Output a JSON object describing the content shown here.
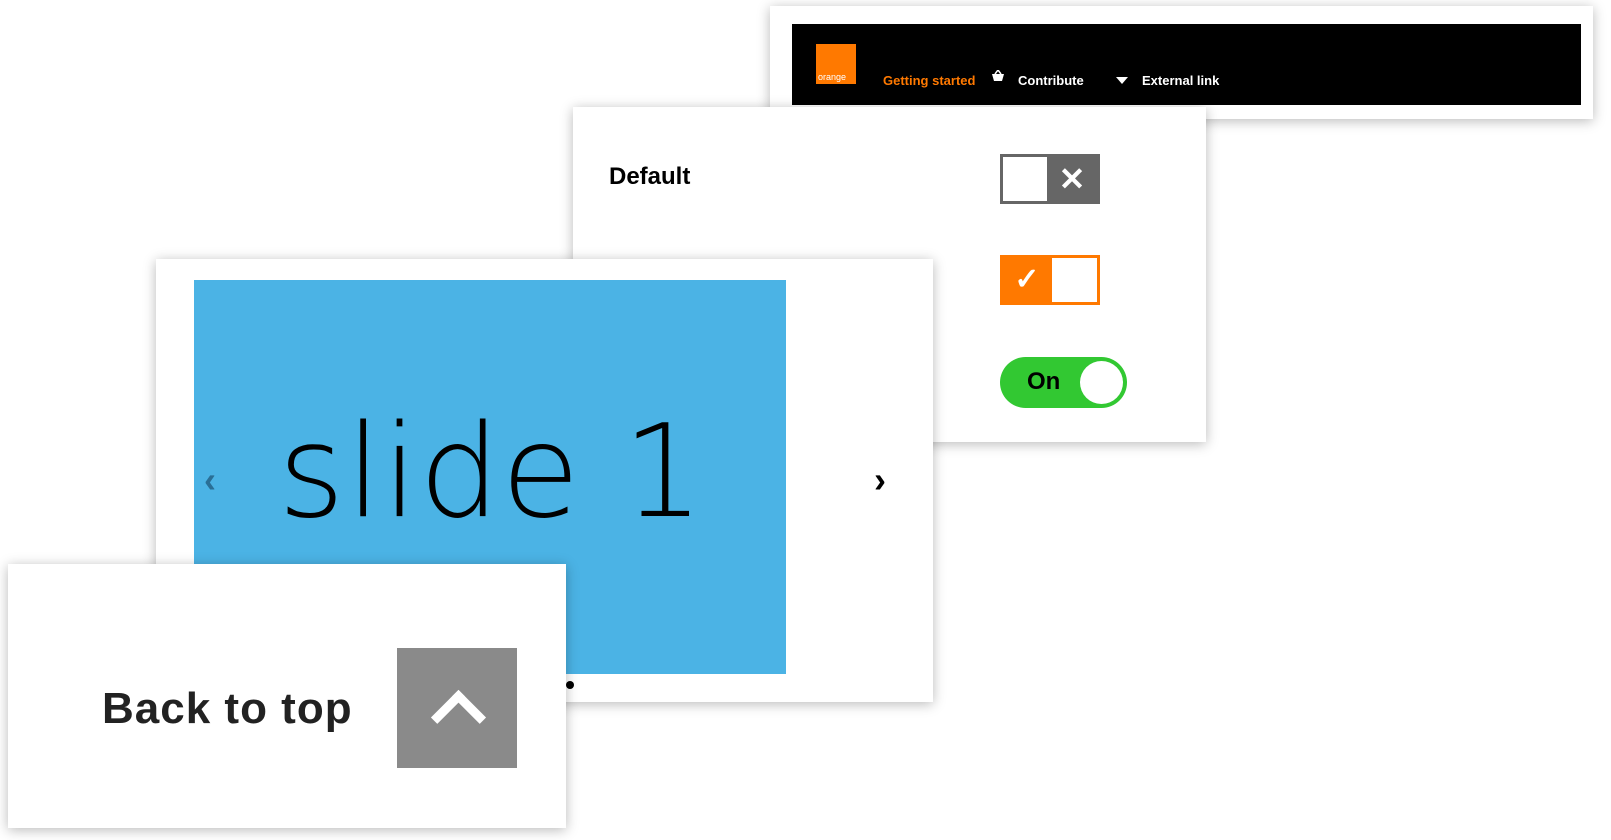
{
  "navbar": {
    "logo_text": "orange",
    "getting_started": "Getting started",
    "basket_icon": "basket-icon",
    "contribute": "Contribute",
    "external_link": "External link",
    "accent_color": "#ff7900"
  },
  "switches": {
    "default_label": "Default",
    "pill_label": "On",
    "states": [
      false,
      true,
      true
    ]
  },
  "carousel": {
    "slide_text": "slide 1",
    "slide_color": "#4bb3e5",
    "prev_icon": "chevron-left-icon",
    "next_icon": "chevron-right-icon",
    "prev_glyph": "‹",
    "next_glyph": "›"
  },
  "back_to_top": {
    "label": "Back to top",
    "icon": "chevron-up-icon"
  }
}
